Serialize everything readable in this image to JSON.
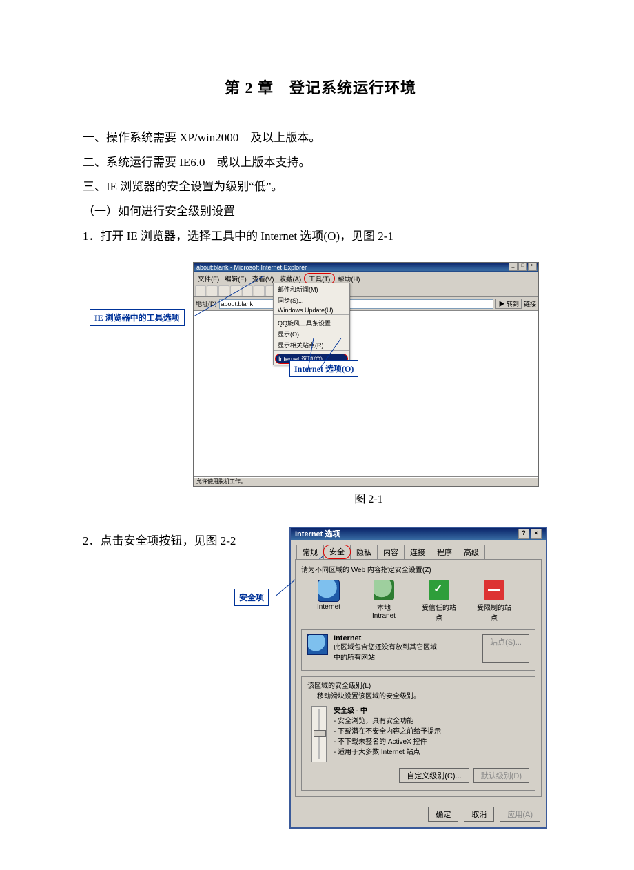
{
  "title": "第 2 章　登记系统运行环境",
  "para1": "一、操作系统需要 XP/win2000　及以上版本。",
  "para2": "二、系统运行需要 IE6.0　或以上版本支持。",
  "para3": "三、IE 浏览器的安全设置为级别“低”。",
  "para4": "（一）如何进行安全级别设置",
  "para5": "1．打开 IE 浏览器，选择工具中的 Internet 选项(O)，见图 2-1",
  "fig1": {
    "caption": "图 2-1",
    "windowTitle": "about:blank - Microsoft Internet Explorer",
    "menu": {
      "file": "文件(F)",
      "edit": "编辑(E)",
      "view": "查看(V)",
      "fav": "收藏(A)",
      "tools": "工具(T)",
      "help": "帮助(H)"
    },
    "addrLabel": "地址(D)",
    "addrValue": "about:blank",
    "goLabel": "转到",
    "linksLabel": "链接",
    "dropdown": {
      "i1": "邮件和新闻(M)",
      "i2": "同步(S)...",
      "i3": "Windows Update(U)",
      "i4": "QQ旋风工具条设置",
      "i5": "显示(O)",
      "i6": "显示相关站点(R)",
      "hl": "Internet 选项(O)..."
    },
    "status": "允许使用脱机工作。",
    "callout1": "IE 浏览器中的工具选项",
    "callout2": "Internet 选项(O)"
  },
  "para6": "2．点击安全项按钮，见图 2-2",
  "fig2": {
    "dlgTitle": "Internet 选项",
    "tabs": {
      "t1": "常规",
      "t2": "安全",
      "t3": "隐私",
      "t4": "内容",
      "t5": "连接",
      "t6": "程序",
      "t7": "高级"
    },
    "instr": "请为不同区域的 Web 内容指定安全设置(Z)",
    "zones": {
      "z1": "Internet",
      "z2": "本地\nIntranet",
      "z3": "受信任的站\n点",
      "z4": "受限制的站\n点"
    },
    "zoneHead": "Internet",
    "zoneDesc": "此区域包含您还没有放到其它区域\n中的所有网站",
    "sitesBtn": "站点(S)...",
    "levelLabel": "该区域的安全级别(L)",
    "levelHint": "移动滑块设置该区域的安全级别。",
    "levelName": "安全级 - 中",
    "b1": "- 安全浏览，具有安全功能",
    "b2": "- 下载潜在不安全内容之前给予提示",
    "b3": "- 不下载未签名的 ActiveX 控件",
    "b4": "- 适用于大多数 Internet 站点",
    "custom": "自定义级别(C)...",
    "default": "默认级别(D)",
    "ok": "确定",
    "cancel": "取消",
    "apply": "应用(A)",
    "callout": "安全项"
  }
}
